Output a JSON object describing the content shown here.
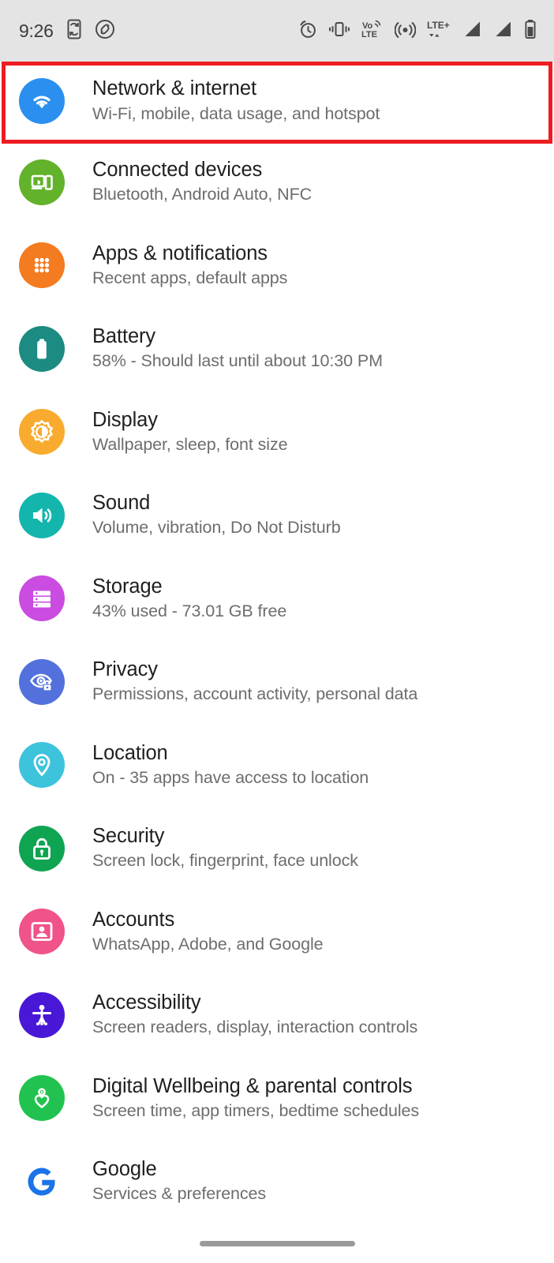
{
  "status_bar": {
    "time": "9:26",
    "left_icons": [
      "screen-rotate-icon",
      "shazam-icon"
    ],
    "right_icons": [
      "alarm-icon",
      "vibrate-icon",
      "volte-icon",
      "hotspot-icon",
      "lte-plus-icon",
      "signal-bars-sim1-icon",
      "signal-bars-sim2-icon",
      "battery-icon"
    ],
    "network_label": "LTE+",
    "volte_label_top": "Vo",
    "volte_label_bottom": "LTE",
    "background_color": "#e4e4e4"
  },
  "highlight": {
    "color": "#ee1c21",
    "target_index": 0
  },
  "settings": {
    "items": [
      {
        "title": "Network & internet",
        "subtitle": "Wi-Fi, mobile, data usage, and hotspot",
        "icon": "wifi-icon",
        "icon_color": "#2b8fef",
        "name": "network-and-internet"
      },
      {
        "title": "Connected devices",
        "subtitle": "Bluetooth, Android Auto, NFC",
        "icon": "connected-devices-icon",
        "icon_color": "#63b22b",
        "name": "connected-devices"
      },
      {
        "title": "Apps & notifications",
        "subtitle": "Recent apps, default apps",
        "icon": "apps-grid-icon",
        "icon_color": "#f47b20",
        "name": "apps-and-notifications"
      },
      {
        "title": "Battery",
        "subtitle": "58% - Should last until about 10:30 PM",
        "icon": "battery-icon",
        "icon_color": "#1c8b82",
        "name": "battery"
      },
      {
        "title": "Display",
        "subtitle": "Wallpaper, sleep, font size",
        "icon": "brightness-icon",
        "icon_color": "#f8ab2e",
        "name": "display"
      },
      {
        "title": "Sound",
        "subtitle": "Volume, vibration, Do Not Disturb",
        "icon": "speaker-icon",
        "icon_color": "#14b5ad",
        "name": "sound"
      },
      {
        "title": "Storage",
        "subtitle": "43% used - 73.01 GB free",
        "icon": "storage-icon",
        "icon_color": "#ca4ce0",
        "name": "storage"
      },
      {
        "title": "Privacy",
        "subtitle": "Permissions, account activity, personal data",
        "icon": "privacy-eye-lock-icon",
        "icon_color": "#5271dd",
        "name": "privacy"
      },
      {
        "title": "Location",
        "subtitle": "On - 35 apps have access to location",
        "icon": "location-pin-icon",
        "icon_color": "#3ec3dd",
        "name": "location"
      },
      {
        "title": "Security",
        "subtitle": "Screen lock, fingerprint, face unlock",
        "icon": "lock-icon",
        "icon_color": "#0fa452",
        "name": "security"
      },
      {
        "title": "Accounts",
        "subtitle": "WhatsApp, Adobe, and Google",
        "icon": "account-card-icon",
        "icon_color": "#f0528a",
        "name": "accounts"
      },
      {
        "title": "Accessibility",
        "subtitle": "Screen readers, display, interaction controls",
        "icon": "accessibility-icon",
        "icon_color": "#4918d6",
        "name": "accessibility"
      },
      {
        "title": "Digital Wellbeing & parental controls",
        "subtitle": "Screen time, app timers, bedtime schedules",
        "icon": "wellbeing-heart-icon",
        "icon_color": "#21c24f",
        "name": "digital-wellbeing"
      },
      {
        "title": "Google",
        "subtitle": "Services & preferences",
        "icon": "google-g-icon",
        "icon_color": "#1a73e8",
        "name": "google"
      }
    ]
  },
  "nav_bar": {
    "gesture_pill": "home-gesture-pill"
  }
}
